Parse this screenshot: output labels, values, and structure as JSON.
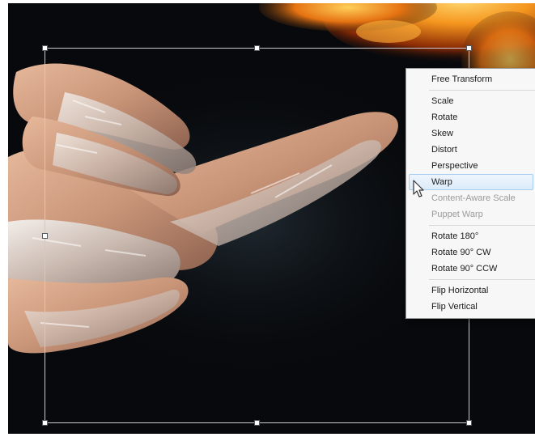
{
  "context_menu": {
    "items": [
      {
        "label": "Free Transform",
        "enabled": true
      },
      {
        "separator": true
      },
      {
        "label": "Scale",
        "enabled": true
      },
      {
        "label": "Rotate",
        "enabled": true
      },
      {
        "label": "Skew",
        "enabled": true
      },
      {
        "label": "Distort",
        "enabled": true
      },
      {
        "label": "Perspective",
        "enabled": true
      },
      {
        "label": "Warp",
        "enabled": true,
        "highlighted": true
      },
      {
        "label": "Content-Aware Scale",
        "enabled": false
      },
      {
        "label": "Puppet Warp",
        "enabled": false
      },
      {
        "separator": true
      },
      {
        "label": "Rotate 180°",
        "enabled": true
      },
      {
        "label": "Rotate 90° CW",
        "enabled": true
      },
      {
        "label": "Rotate 90° CCW",
        "enabled": true
      },
      {
        "separator": true
      },
      {
        "label": "Flip Horizontal",
        "enabled": true
      },
      {
        "label": "Flip Vertical",
        "enabled": true
      }
    ]
  },
  "colors": {
    "canvas_background": "#07090c",
    "menu_background": "#f7f7f7",
    "menu_highlight": "#dcebfa",
    "fire": "#f08a1c",
    "skin": "#c99578"
  }
}
